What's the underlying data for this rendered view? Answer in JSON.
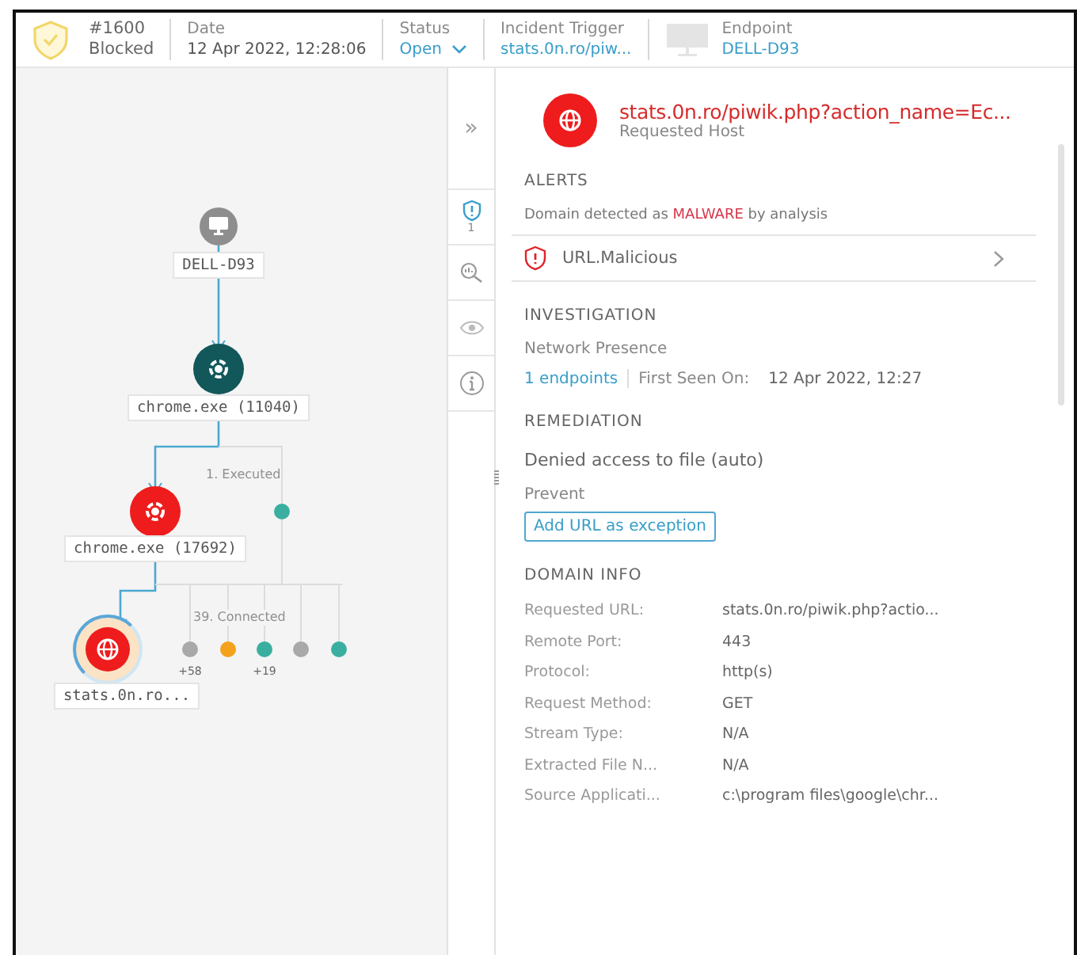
{
  "header": {
    "id": "#1600",
    "state": "Blocked",
    "fields": [
      {
        "kind": "text",
        "label": "Date",
        "value": "12 Apr 2022, 12:28:06"
      },
      {
        "kind": "dropdown",
        "label": "Status",
        "value": "Open"
      },
      {
        "kind": "link",
        "label": "Incident Trigger",
        "value": "stats.0n.ro/piw..."
      },
      {
        "kind": "device",
        "label": "Endpoint",
        "value": "DELL-D93"
      }
    ]
  },
  "graph": {
    "nodes": [
      {
        "kind": "computer",
        "label": "DELL-D93",
        "color": "#8e8e8e"
      },
      {
        "kind": "process",
        "label": "chrome.exe (11040)",
        "color": "#12575a"
      },
      {
        "kind": "process",
        "label": "chrome.exe (17692)",
        "color": "#ee1c1c"
      },
      {
        "kind": "globe",
        "label": "stats.0n.ro...",
        "color": "#ee1c1c"
      }
    ],
    "edge_labels": [
      "1. Executed",
      "39. Connected"
    ],
    "dots": [
      {
        "color": "#3aafa0"
      },
      {
        "color": "#a9a9a9",
        "count": "+58"
      },
      {
        "color": "#f4a21c"
      },
      {
        "color": "#3aafa0",
        "count": "+19"
      },
      {
        "color": "#a9a9a9"
      },
      {
        "color": "#3aafa0"
      }
    ]
  },
  "side_tabs": [
    {
      "kind": "collapse",
      "label": "»"
    },
    {
      "kind": "alerts",
      "count": "1"
    },
    {
      "kind": "investigate"
    },
    {
      "kind": "view"
    },
    {
      "kind": "info"
    }
  ],
  "details": {
    "title": "stats.0n.ro/piwik.php?action_name=Ec...",
    "subtitle": "Requested Host",
    "alerts": {
      "heading": "ALERTS",
      "text": [
        {
          "text": "Domain detected as ",
          "highlight": false
        },
        {
          "text": "MALWARE",
          "highlight": true
        },
        {
          "text": " by analysis",
          "highlight": false
        }
      ],
      "item": "URL.Malicious"
    },
    "investigation": {
      "heading": "INVESTIGATION",
      "label": "Network Presence",
      "endpoints": "1 endpoints",
      "first_seen_label": "First Seen On:",
      "first_seen": "12 Apr 2022, 12:27"
    },
    "remediation": {
      "heading": "REMEDIATION",
      "action": "Denied access to file (auto)",
      "label": "Prevent",
      "button": "Add URL as exception"
    },
    "domain_info": {
      "heading": "DOMAIN INFO",
      "rows": [
        {
          "label": "Requested URL:",
          "value": "stats.0n.ro/piwik.php?actio..."
        },
        {
          "label": "Remote Port:",
          "value": "443"
        },
        {
          "label": "Protocol:",
          "value": "http(s)"
        },
        {
          "label": "Request Method:",
          "value": "GET"
        },
        {
          "label": "Stream Type:",
          "value": "N/A"
        },
        {
          "label": "Extracted File N...",
          "value": "N/A"
        },
        {
          "label": "Source Applicati...",
          "value": "c:\\program files\\google\\chr..."
        }
      ]
    }
  }
}
